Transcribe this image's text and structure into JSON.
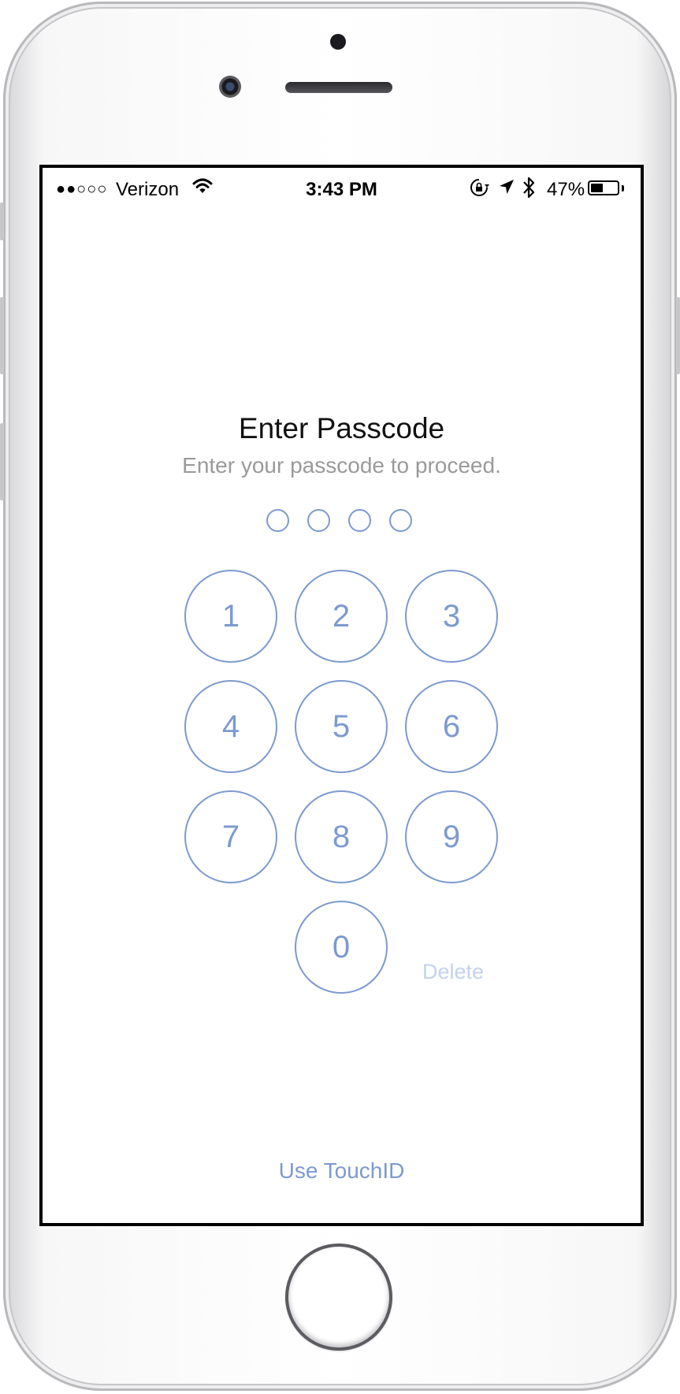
{
  "status_bar": {
    "signal": "●●○○○",
    "carrier": "Verizon",
    "time": "3:43 PM",
    "battery_percent": "47%",
    "battery_level": 0.47,
    "icons": [
      "wifi-icon",
      "orientation-lock-icon",
      "location-arrow-icon",
      "bluetooth-icon",
      "battery-icon"
    ]
  },
  "passcode": {
    "title": "Enter Passcode",
    "subtitle": "Enter your passcode to proceed.",
    "digit_count": 4,
    "entered": 0
  },
  "keypad": {
    "keys": [
      "1",
      "2",
      "3",
      "4",
      "5",
      "6",
      "7",
      "8",
      "9",
      "0"
    ],
    "delete_label": "Delete"
  },
  "footer": {
    "touchid_label": "Use TouchID"
  },
  "colors": {
    "accent": "#7c9ad0",
    "accent_disabled": "#c5d2ec",
    "subtitle": "#9a9a9a"
  }
}
